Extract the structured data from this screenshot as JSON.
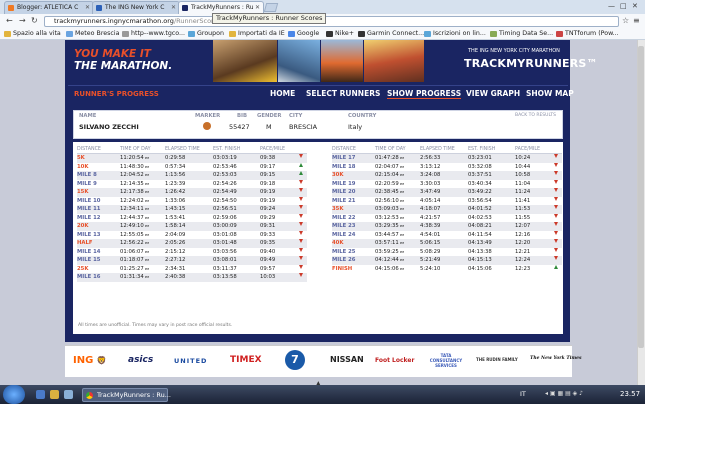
{
  "browser": {
    "tabs": [
      {
        "label": "Blogger: ATLETICA C",
        "active": false
      },
      {
        "label": "The ING New York C",
        "active": false
      },
      {
        "label": "TrackMyRunners : Ru",
        "active": true
      }
    ],
    "url_host": "trackmyrunners.ingnycmarathon.org",
    "url_path": "/RunnerScore",
    "tooltip": "TrackMyRunners : Runner Scores",
    "bookmarks": [
      "Spazio alla vita",
      "Meteo Brescia",
      "http--www.tgco...",
      "Groupon",
      "Importati da IE",
      "Google",
      "Nike+",
      "Garmin Connect...",
      "Iscrizioni on lin...",
      "Timing Data Se...",
      "TNTforum (Pow..."
    ]
  },
  "header": {
    "tagline_part1": "YOU MAKE IT",
    "tagline_part2": "THE MARATHON.",
    "tmr_sub": "THE ING NEW YORK CITY MARATHON",
    "tmr_logo": "TRACKMYRUNNERS™"
  },
  "nav": {
    "title": "RUNNER'S PROGRESS",
    "links": [
      "HOME",
      "SELECT RUNNERS",
      "SHOW PROGRESS",
      "VIEW GRAPH",
      "SHOW MAP"
    ]
  },
  "runner": {
    "headers": [
      "NAME",
      "MARKER",
      "BIB",
      "GENDER",
      "CITY",
      "COUNTRY"
    ],
    "name": "SILVANO ZECCHI",
    "bib": "55427",
    "gender": "M",
    "city": "BRESCIA",
    "country": "Italy",
    "back_link": "BACK TO RESULTS"
  },
  "splits": {
    "headers": [
      "DISTANCE",
      "TIME OF DAY",
      "ELAPSED TIME",
      "EST. FINISH",
      "PACE/MILE"
    ],
    "left": [
      [
        "5K",
        "11:20:54",
        "0:29:58",
        "03:03:19",
        "09:38",
        "down"
      ],
      [
        "10K",
        "11:48:30",
        "0:57:34",
        "02:53:46",
        "09:17",
        "up"
      ],
      [
        "MILE 8",
        "12:04:52",
        "1:13:56",
        "02:53:03",
        "09:15",
        "up"
      ],
      [
        "MILE 9",
        "12:14:35",
        "1:23:39",
        "02:54:26",
        "09:18",
        "down"
      ],
      [
        "15K",
        "12:17:38",
        "1:26:42",
        "02:54:49",
        "09:19",
        "down"
      ],
      [
        "MILE 10",
        "12:24:02",
        "1:33:06",
        "02:54:50",
        "09:19",
        "down"
      ],
      [
        "MILE 11",
        "12:34:11",
        "1:43:15",
        "02:56:51",
        "09:24",
        "down"
      ],
      [
        "MILE 12",
        "12:44:37",
        "1:53:41",
        "02:59:06",
        "09:29",
        "down"
      ],
      [
        "20K",
        "12:49:10",
        "1:58:14",
        "03:00:09",
        "09:31",
        "down"
      ],
      [
        "MILE 13",
        "12:55:05",
        "2:04:09",
        "03:01:08",
        "09:33",
        "down"
      ],
      [
        "HALF",
        "12:56:22",
        "2:05:26",
        "03:01:48",
        "09:35",
        "down"
      ],
      [
        "MILE 14",
        "01:06:07",
        "2:15:12",
        "03:03:56",
        "09:40",
        "down"
      ],
      [
        "MILE 15",
        "01:18:07",
        "2:27:12",
        "03:08:01",
        "09:49",
        "down"
      ],
      [
        "25K",
        "01:25:27",
        "2:34:31",
        "03:11:37",
        "09:57",
        "down"
      ],
      [
        "MILE 16",
        "01:31:34",
        "2:40:38",
        "03:13:58",
        "10:03",
        "down"
      ]
    ],
    "right": [
      [
        "MILE 17",
        "01:47:28",
        "2:56:33",
        "03:23:01",
        "10:24",
        "down"
      ],
      [
        "MILE 18",
        "02:04:07",
        "3:13:12",
        "03:32:08",
        "10:44",
        "down"
      ],
      [
        "30K",
        "02:15:04",
        "3:24:08",
        "03:37:51",
        "10:58",
        "down"
      ],
      [
        "MILE 19",
        "02:20:59",
        "3:30:03",
        "03:40:34",
        "11:04",
        "down"
      ],
      [
        "MILE 20",
        "02:38:45",
        "3:47:49",
        "03:49:22",
        "11:24",
        "down"
      ],
      [
        "MILE 21",
        "02:56:10",
        "4:05:14",
        "03:56:54",
        "11:41",
        "down"
      ],
      [
        "35K",
        "03:09:03",
        "4:18:07",
        "04:01:52",
        "11:53",
        "down"
      ],
      [
        "MILE 22",
        "03:12:53",
        "4:21:57",
        "04:02:53",
        "11:55",
        "down"
      ],
      [
        "MILE 23",
        "03:29:35",
        "4:38:39",
        "04:08:21",
        "12:07",
        "down"
      ],
      [
        "MILE 24",
        "03:44:57",
        "4:54:01",
        "04:11:54",
        "12:16",
        "down"
      ],
      [
        "40K",
        "03:57:11",
        "5:06:15",
        "04:13:49",
        "12:20",
        "down"
      ],
      [
        "MILE 25",
        "03:59:25",
        "5:08:29",
        "04:13:38",
        "12:21",
        "down"
      ],
      [
        "MILE 26",
        "04:12:44",
        "5:21:49",
        "04:15:13",
        "12:24",
        "down"
      ],
      [
        "FINISH",
        "04:15:06",
        "5:24:10",
        "04:15:06",
        "12:23",
        "up"
      ]
    ],
    "time_suffix": "PM",
    "footnote": "All times are unofficial. Times may vary in post race official results."
  },
  "sponsors": [
    "ING",
    "asics",
    "UNITED",
    "TIMEX",
    "7",
    "NISSAN",
    "Foot Locker",
    "TATA CONSULTANCY SERVICES",
    "THE RUDIN FAMILY",
    "The New York Times"
  ],
  "taskbar": {
    "task": "TrackMyRunners : Ru...",
    "tray": "IT",
    "clock": "23.57"
  },
  "colors": {
    "accent": "#e8502a",
    "navy": "#1a2562"
  }
}
